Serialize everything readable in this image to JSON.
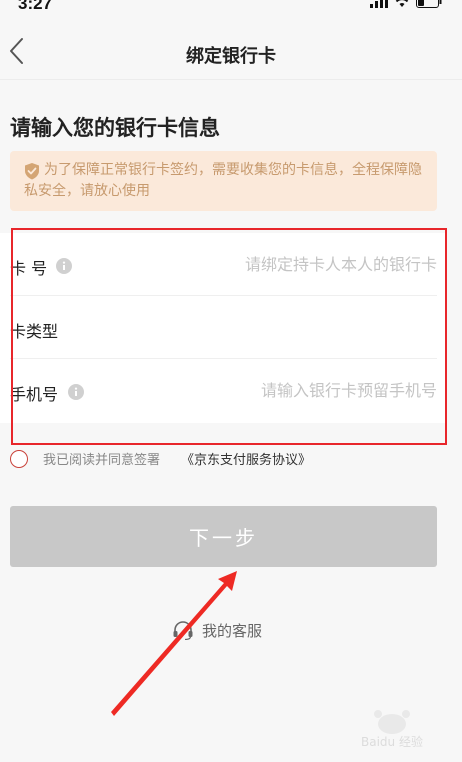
{
  "status_bar": {
    "time": "3:27"
  },
  "nav": {
    "title": "绑定银行卡"
  },
  "heading": "请输入您的银行卡信息",
  "notice": {
    "text": "为了保障正常银行卡签约，需要收集您的卡信息，全程保障隐私安全，请放心使用"
  },
  "form": {
    "card_number": {
      "label": "卡 号",
      "placeholder": "请绑定持卡人本人的银行卡"
    },
    "card_type": {
      "label": "卡类型"
    },
    "phone": {
      "label": "手机号",
      "placeholder": "请输入银行卡预留手机号"
    }
  },
  "agreement": {
    "text": "我已阅读并同意签署",
    "link": "《京东支付服务协议》"
  },
  "next_button": "下一步",
  "service": {
    "label": "我的客服"
  },
  "colors": {
    "highlight": "#e8262b",
    "notice_bg": "#fbe9da",
    "notice_text": "#c79a6e",
    "button_disabled": "#c8c8c8"
  }
}
